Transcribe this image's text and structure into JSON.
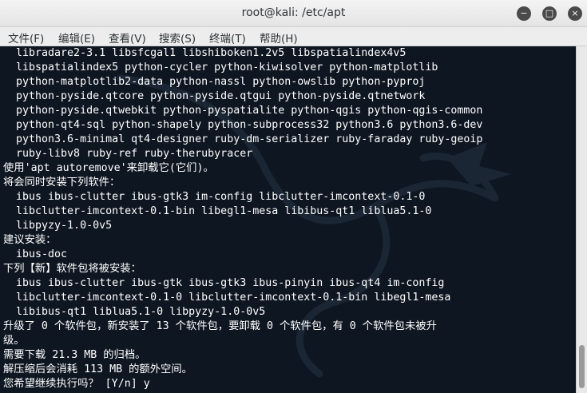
{
  "window": {
    "title": "root@kali: /etc/apt",
    "minimize_glyph": "−",
    "maximize_glyph": "□",
    "close_glyph": "×"
  },
  "menubar": {
    "items": [
      "文件(F)",
      "编辑(E)",
      "查看(V)",
      "搜索(S)",
      "终端(T)",
      "帮助(H)"
    ]
  },
  "terminal": {
    "lines": [
      "  libradare2-3.1 libsfcgal1 libshiboken1.2v5 libspatialindex4v5",
      "  libspatialindex5 python-cycler python-kiwisolver python-matplotlib",
      "  python-matplotlib2-data python-nassl python-owslib python-pyproj",
      "  python-pyside.qtcore python-pyside.qtgui python-pyside.qtnetwork",
      "  python-pyside.qtwebkit python-pyspatialite python-qgis python-qgis-common",
      "  python-qt4-sql python-shapely python-subprocess32 python3.6 python3.6-dev",
      "  python3.6-minimal qt4-designer ruby-dm-serializer ruby-faraday ruby-geoip",
      "  ruby-libv8 ruby-ref ruby-therubyracer",
      "使用'apt autoremove'来卸载它(它们)。",
      "将会同时安装下列软件：",
      "  ibus ibus-clutter ibus-gtk3 im-config libclutter-imcontext-0.1-0",
      "  libclutter-imcontext-0.1-bin libegl1-mesa libibus-qt1 liblua5.1-0",
      "  libpyzy-1.0-0v5",
      "建议安装：",
      "  ibus-doc",
      "下列【新】软件包将被安装：",
      "  ibus ibus-clutter ibus-gtk ibus-gtk3 ibus-pinyin ibus-qt4 im-config",
      "  libclutter-imcontext-0.1-0 libclutter-imcontext-0.1-bin libegl1-mesa",
      "  libibus-qt1 liblua5.1-0 libpyzy-1.0-0v5",
      "升级了 0 个软件包，新安装了 13 个软件包，要卸载 0 个软件包，有 0 个软件包未被升",
      "级。",
      "需要下载 21.3 MB 的归档。",
      "解压缩后会消耗 113 MB 的额外空间。",
      "您希望继续执行吗？ [Y/n] y"
    ]
  },
  "colors": {
    "terminal_bg": "#0e1621",
    "terminal_fg": "#ffffff",
    "titlebar_bg": "#ededed"
  },
  "icons": [
    "minimize-icon",
    "maximize-icon",
    "close-icon",
    "kali-dragon-watermark-icon"
  ]
}
